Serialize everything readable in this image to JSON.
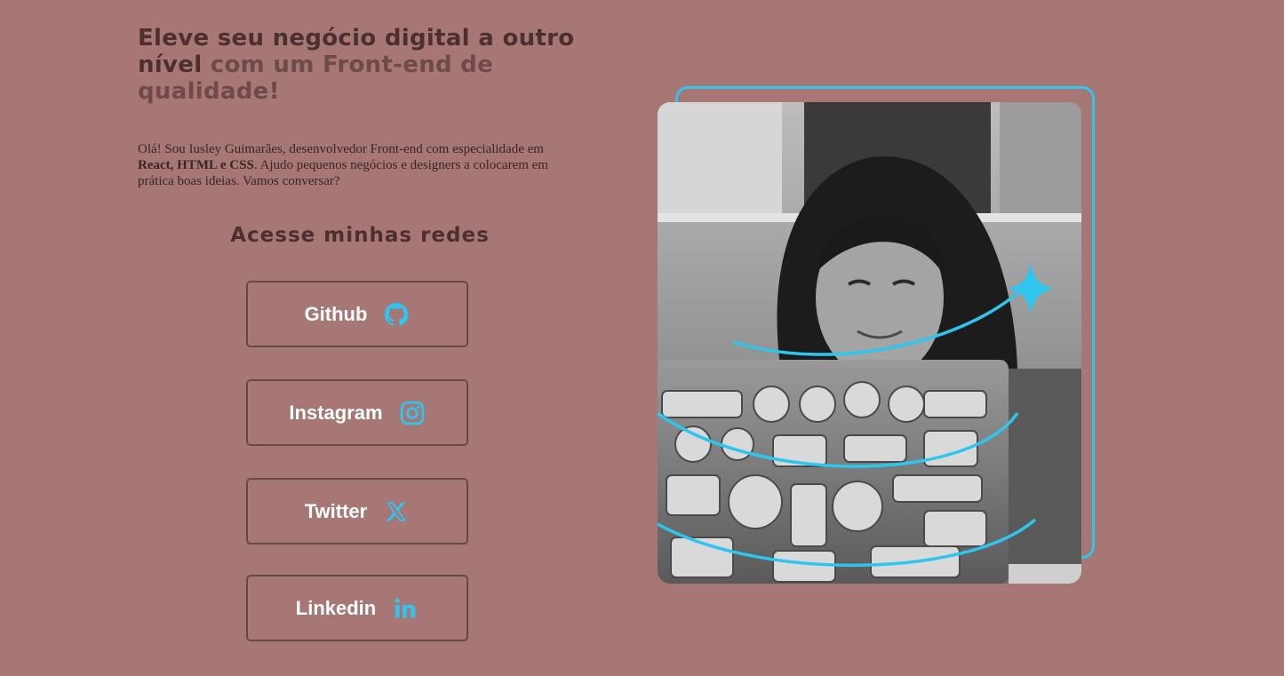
{
  "hero": {
    "headline_dark": "Eleve seu negócio digital a outro nível",
    "headline_light": "com um Front-end de qualidade!",
    "intro_part1": "Olá! Sou Iusley Guimarães, desenvolvedor Front-end com especialidade em",
    "intro_bold": "React, HTML e CSS",
    "intro_part2": ". Ajudo pequenos negócios e designers a colocarem em prática boas ideias. Vamos conversar?"
  },
  "networks": {
    "title": "Acesse minhas redes",
    "buttons": [
      {
        "label": "Github",
        "icon": "github-icon"
      },
      {
        "label": "Instagram",
        "icon": "instagram-icon"
      },
      {
        "label": "Twitter",
        "icon": "x-twitter-icon"
      },
      {
        "label": "Linkedin",
        "icon": "linkedin-icon"
      }
    ]
  },
  "colors": {
    "background": "#a67775",
    "accent": "#2ec5ef",
    "heading_dark": "#4d2f30",
    "heading_light": "#6e4a4a",
    "button_border": "#6b4848",
    "button_text": "#ffffff"
  },
  "photo": {
    "icon": "profile-photo",
    "decoration": "sparkle-star-icon"
  }
}
